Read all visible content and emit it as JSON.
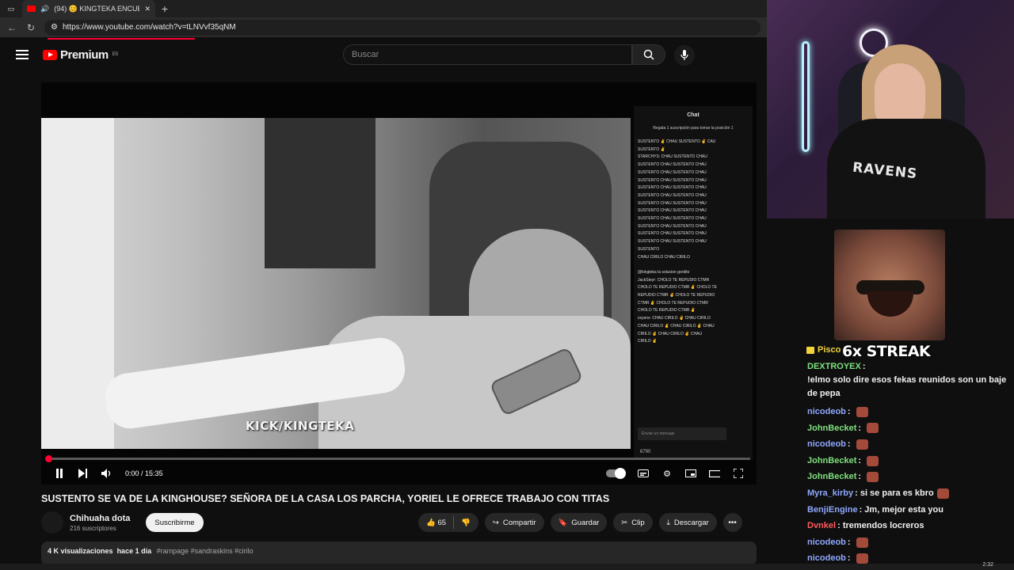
{
  "browser": {
    "tab_title": "(94) 😊 KINGTEKA ENCUENT",
    "url": "https://www.youtube.com/watch?v=tLNVvf35qNM"
  },
  "youtube": {
    "logo_text": "Premium",
    "region": "ES",
    "search_placeholder": "Buscar"
  },
  "player": {
    "watermark": "KICK/KINGTEKA",
    "time_current": "0:00",
    "time_sep": " / ",
    "time_total": "15:35",
    "progress_fraction": 0.0,
    "stream_chat": {
      "header": "Chat",
      "pinned": "Regala 1 suscripción para tomar la posición 1",
      "lines": [
        "SUSTENTO ✌ CHAU SUSTENTO ✌ CAU",
        "SUSTENTO ✌",
        "STARCHYS: CHAU SUSTENTO CHAU",
        "SUSTENTO CHAU SUSTENTO CHAU",
        "SUSTENTO CHAU SUSTENTO CHAU",
        "SUSTENTO CHAU SUSTENTO CHAU",
        "SUSTENTO CHAU SUSTENTO CHAU",
        "SUSTENTO CHAU SUSTENTO CHAU",
        "SUSTENTO CHAU SUSTENTO CHAU",
        "SUSTENTO CHAU SUSTENTO CHAU",
        "SUSTENTO CHAU SUSTENTO CHAU",
        "SUSTENTO CHAU SUSTENTO CHAU",
        "SUSTENTO CHAU SUSTENTO CHAU",
        "SUSTENTO CHAU SUSTENTO CHAU",
        "SUSTENTO",
        "CHAU CIRILO CHAU CIRILO",
        "",
        "@kingteka la solucion gordito",
        "JackSteyr: CHOLO TE REPUDIO CTMR",
        "CHOLO TE REPUDIO CTMR ✌ CHOLO TE",
        "REPUDIO CTMR ✌ CHOLO TE REPUDIO",
        "CTMR ✌ CHOLO TE REPUDIO CTMR",
        "CHOLO TE REPUDIO CTMR ✌",
        "xxyenx: CHAU CIRILO ✌ CHAU CIRILO",
        "CHAU CIRILO ✌ CHAU CIRILO ✌ CHAU",
        "CIRILO ✌ CHAU CIRILO ✌ CHAU",
        "CIRILO ✌"
      ],
      "input_placeholder": "Enviar un mensaje",
      "viewer_count": "6790"
    }
  },
  "video": {
    "title": "SUSTENTO SE VA DE LA KINGHOUSE? SEÑORA DE LA CASA LOS PARCHA, YORIEL LE OFRECE TRABAJO CON TITAS",
    "channel": "Chihuaha dota",
    "subscribers": "216 suscriptores",
    "subscribe_label": "Suscribirme",
    "likes": "65",
    "share_label": "Compartir",
    "save_label": "Guardar",
    "clip_label": "Clip",
    "download_label": "Descargar",
    "views": "4 K visualizaciones",
    "date": "hace 1 día",
    "hashtags": "#rampage #sandraskins #cirilo"
  },
  "overlay": {
    "jersey_text": "RAVENS",
    "streak_text": "6x STREAK",
    "top_user": "Pisco"
  },
  "live_chat": [
    {
      "user": "DEXTROYEX",
      "color": "#7fe07f",
      "text": "!elmo solo dire esos fekas reunidos son un baje de pepa",
      "emote": false
    },
    {
      "user": "nicodeob",
      "color": "#8fa8ff",
      "text": "",
      "emote": true
    },
    {
      "user": "JohnBecket",
      "color": "#7fe07f",
      "text": "",
      "emote": true
    },
    {
      "user": "nicodeob",
      "color": "#8fa8ff",
      "text": "",
      "emote": true
    },
    {
      "user": "JohnBecket",
      "color": "#7fe07f",
      "text": "",
      "emote": true
    },
    {
      "user": "JohnBecket",
      "color": "#7fe07f",
      "text": "",
      "emote": true
    },
    {
      "user": "Myra_kirby",
      "color": "#8fa8ff",
      "text": "si se para es kbro",
      "emote": true
    },
    {
      "user": "BenjiEngine",
      "color": "#8fa8ff",
      "text": "Jm, mejor esta you",
      "emote": false
    },
    {
      "user": "Dvnkel",
      "color": "#ff5c5c",
      "text": "tremendos locreros",
      "emote": false
    },
    {
      "user": "nicodeob",
      "color": "#8fa8ff",
      "text": "",
      "emote": true
    },
    {
      "user": "nicodeob",
      "color": "#8fa8ff",
      "text": "",
      "emote": true
    },
    {
      "user": "nicodeob",
      "color": "#8fa8ff",
      "text": "",
      "emote": true
    }
  ],
  "taskbar": {
    "clock": "2:32"
  }
}
